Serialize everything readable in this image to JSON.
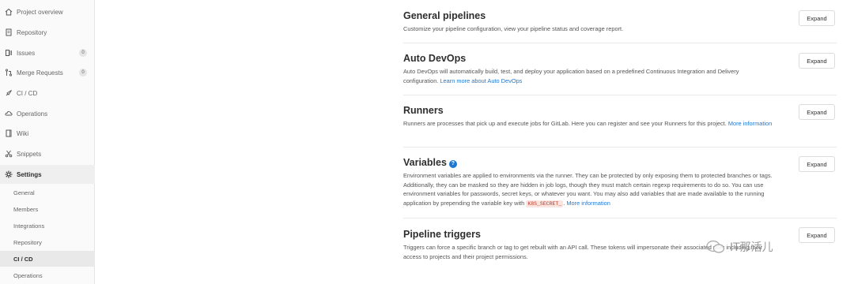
{
  "sidebar": {
    "items": [
      {
        "label": "Project overview",
        "icon": "home-icon"
      },
      {
        "label": "Repository",
        "icon": "repository-icon"
      },
      {
        "label": "Issues",
        "icon": "issues-icon",
        "count": "0"
      },
      {
        "label": "Merge Requests",
        "icon": "merge-request-icon",
        "count": "0"
      },
      {
        "label": "CI / CD",
        "icon": "rocket-icon"
      },
      {
        "label": "Operations",
        "icon": "cloud-icon"
      },
      {
        "label": "Wiki",
        "icon": "book-icon"
      },
      {
        "label": "Snippets",
        "icon": "scissors-icon"
      },
      {
        "label": "Settings",
        "icon": "gear-icon"
      }
    ],
    "settings_sub": [
      "General",
      "Members",
      "Integrations",
      "Repository",
      "CI / CD",
      "Operations"
    ]
  },
  "sections": {
    "general": {
      "title": "General pipelines",
      "desc": "Customize your pipeline configuration, view your pipeline status and coverage report.",
      "button": "Expand"
    },
    "autodevops": {
      "title": "Auto DevOps",
      "desc": "Auto DevOps will automatically build, test, and deploy your application based on a predefined Continuous Integration and Delivery configuration.",
      "link": "Learn more about Auto DevOps",
      "button": "Expand"
    },
    "runners": {
      "title": "Runners",
      "desc": "Runners are processes that pick up and execute jobs for GitLab. Here you can register and see your Runners for this project.",
      "link": "More information",
      "button": "Expand"
    },
    "variables": {
      "title": "Variables",
      "help": "?",
      "desc_a": "Environment variables are applied to environments via the runner. They can be protected by only exposing them to protected branches or tags. Additionally, they can be masked so they are hidden in job logs, though they must match certain regexp requirements to do so. You can use environment variables for passwords, secret keys, or whatever you want. You may also add variables that are made available to the running application by prepending the variable key with",
      "code": "K8S_SECRET_",
      "desc_b": ".",
      "link": "More information",
      "button": "Expand"
    },
    "triggers": {
      "title": "Pipeline triggers",
      "desc": "Triggers can force a specific branch or tag to get rebuilt with an API call. These tokens will impersonate their associated user including their access to projects and their project permissions.",
      "button": "Expand"
    }
  },
  "watermark": "IT那活儿",
  "colors": {
    "link": "#1f78d1",
    "sidebar_bg": "#fafafa",
    "code_bg": "#fbe5e1"
  }
}
